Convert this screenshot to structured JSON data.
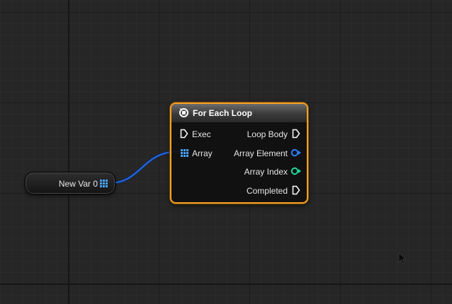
{
  "variable_node": {
    "label": "New Var 0",
    "pin_icon": "array-grid-icon",
    "pin_color": "#3b8dff"
  },
  "foreach_node": {
    "title": "For Each Loop",
    "title_icon": "loop-icon",
    "border_color": "#f7a021",
    "inputs": {
      "exec": "Exec",
      "array": "Array"
    },
    "outputs": {
      "loop_body": "Loop Body",
      "array_element": "Array Element",
      "array_index": "Array Index",
      "completed": "Completed"
    },
    "colors": {
      "exec_pin": "#ffffff",
      "array_pin": "#3b8dff",
      "element_pin": "#2c7fff",
      "index_pin": "#1edc9a"
    }
  },
  "wire": {
    "from": "New Var 0",
    "to": "Array",
    "color": "#1f5fd0"
  }
}
